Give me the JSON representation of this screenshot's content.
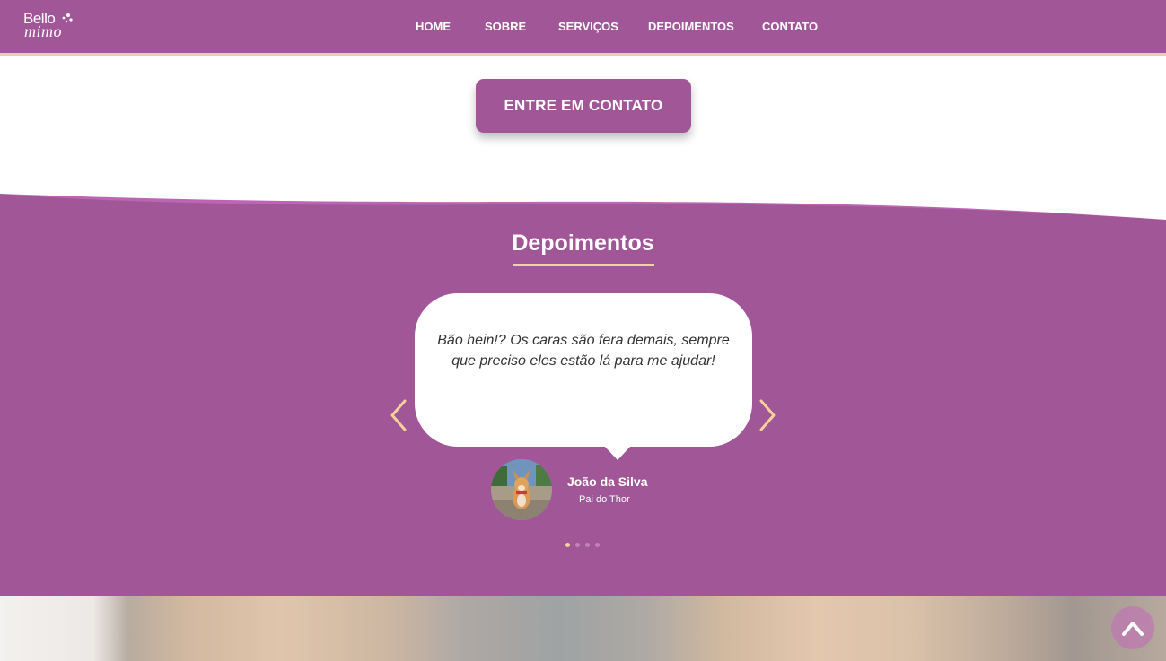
{
  "brand": {
    "logo_top": "Bello",
    "logo_bottom": "mimo"
  },
  "nav": {
    "items": [
      {
        "label": "HOME"
      },
      {
        "label": "SOBRE"
      },
      {
        "label": "SERVIÇOS"
      },
      {
        "label": "DEPOIMENTOS"
      },
      {
        "label": "CONTATO"
      }
    ]
  },
  "cta": {
    "label": "ENTRE EM CONTATO"
  },
  "testimonials": {
    "title": "Depoimentos",
    "current": {
      "quote": "Bão hein!? Os caras são fera demais, sempre que preciso eles estão lá para me ajudar!",
      "author_name": "João da Silva",
      "author_role": "Pai do Thor"
    },
    "slide_count": 4,
    "active_slide": 1
  },
  "icons": {
    "prev": "chevron-left-icon",
    "next": "chevron-right-icon",
    "back_to_top": "chevron-up-icon"
  },
  "colors": {
    "brand_purple": "#a05697",
    "accent_gold": "#f3d39b",
    "nav_border": "#f0c9b4",
    "wave_light": "#bd65b5"
  }
}
